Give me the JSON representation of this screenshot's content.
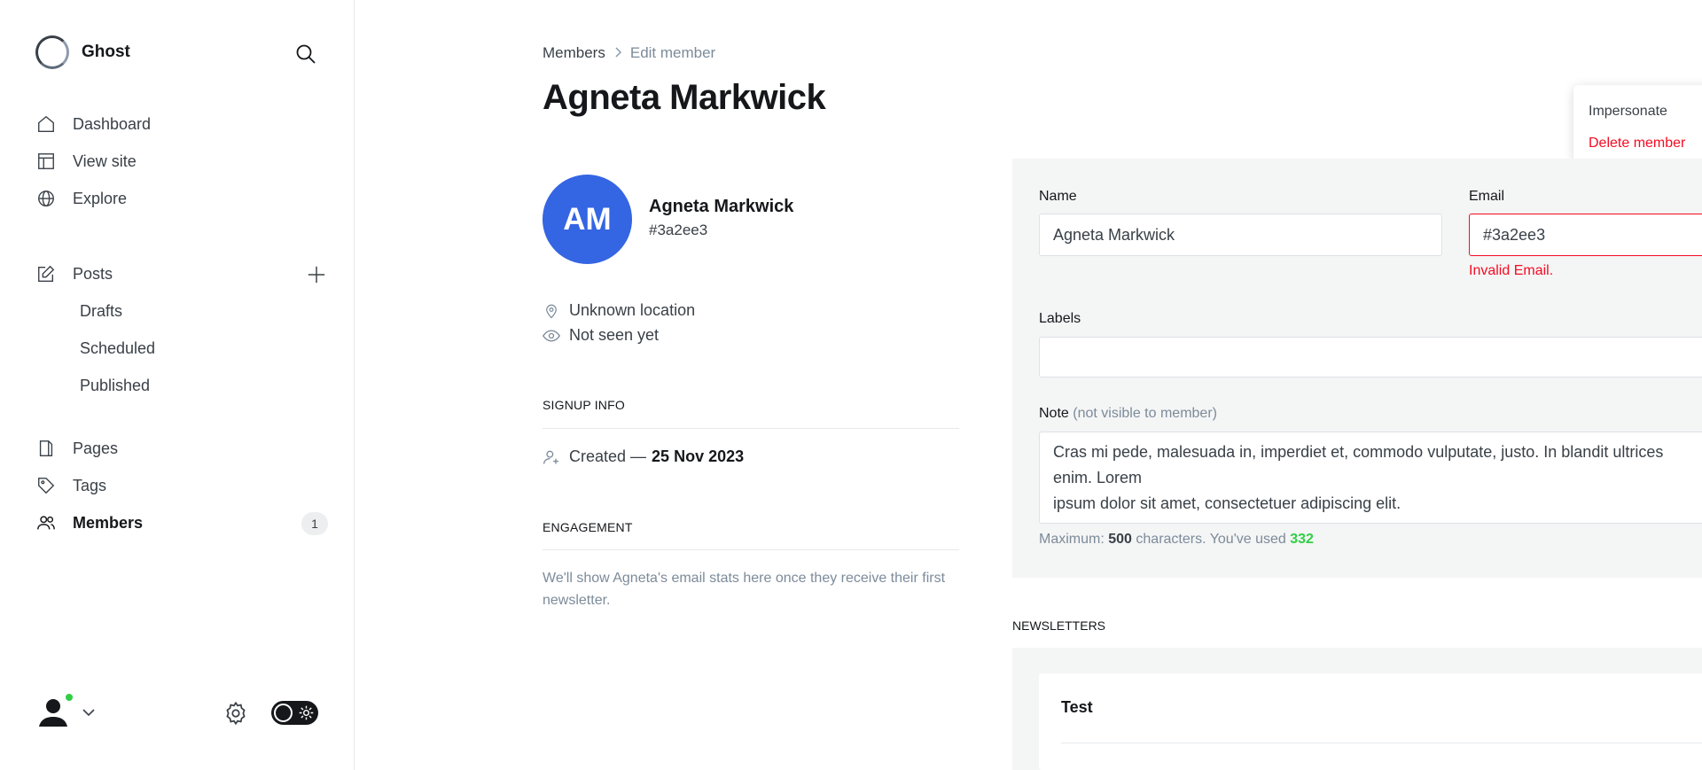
{
  "brand": {
    "name": "Ghost"
  },
  "sidebar": {
    "primary": [
      {
        "label": "Dashboard",
        "icon": "home-icon"
      },
      {
        "label": "View site",
        "icon": "layout-icon"
      },
      {
        "label": "Explore",
        "icon": "globe-icon"
      }
    ],
    "posts": {
      "label": "Posts",
      "icon": "edit-icon",
      "sub": [
        "Drafts",
        "Scheduled",
        "Published"
      ]
    },
    "secondary": [
      {
        "label": "Pages",
        "icon": "page-icon"
      },
      {
        "label": "Tags",
        "icon": "tag-icon"
      },
      {
        "label": "Members",
        "icon": "members-icon",
        "badge": "1",
        "active": true
      }
    ]
  },
  "breadcrumb": {
    "parent": "Members",
    "current": "Edit member"
  },
  "page_title": "Agneta Markwick",
  "actions_menu": {
    "impersonate": "Impersonate",
    "delete": "Delete member"
  },
  "member": {
    "initials": "AM",
    "name": "Agneta Markwick",
    "email": "#3a2ee3",
    "location": "Unknown location",
    "seen": "Not seen yet",
    "avatar_color": "#3465e2"
  },
  "signup": {
    "heading": "SIGNUP INFO",
    "created_prefix": "Created —",
    "created_date": "25 Nov 2023"
  },
  "engagement": {
    "heading": "ENGAGEMENT",
    "text": "We'll show Agneta's email stats here once they receive their first newsletter."
  },
  "form": {
    "name_label": "Name",
    "name_value": "Agneta Markwick",
    "email_label": "Email",
    "email_value": "#3a2ee3",
    "email_error": "Invalid Email.",
    "labels_label": "Labels",
    "labels_value": "",
    "note_label": "Note",
    "note_hint": "(not visible to member)",
    "note_value": "Cras mi pede, malesuada in, imperdiet et, commodo vulputate, justo. In blandit ultrices enim. Lorem\nipsum dolor sit amet, consectetuer adipiscing elit.\n\nProin interdum mauris non ligula pellentesque ultrices. Phasellus id sapien in sapien iaculis congue.",
    "counter_prefix": "Maximum:",
    "counter_max": "500",
    "counter_mid": "characters. You've used",
    "counter_used": "332"
  },
  "newsletters": {
    "heading": "NEWSLETTERS",
    "items": [
      {
        "name": "Test"
      }
    ]
  },
  "colors": {
    "accent": "#3465e2",
    "error": "#f50b23",
    "success": "#30cf43"
  }
}
